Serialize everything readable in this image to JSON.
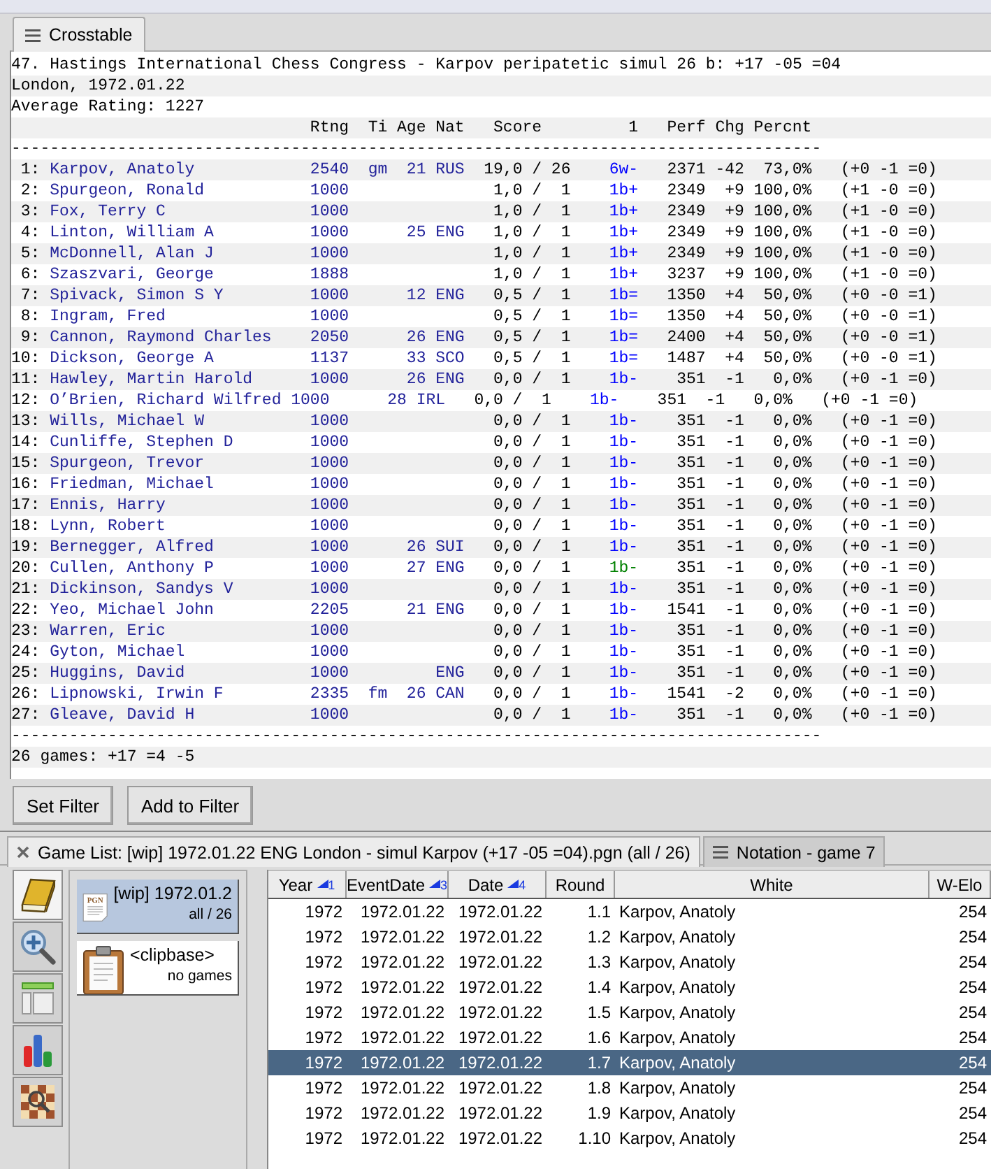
{
  "top_tab": {
    "label": "Crosstable",
    "selected": true
  },
  "crosstable": {
    "title_line": "47. Hastings International Chess Congress - Karpov peripatetic simul 26 b: +17 -05 =04",
    "place_line": "London, 1972.01.22",
    "average_line": "Average Rating: 1227",
    "header": {
      "rating": "Rtng",
      "title": "Ti",
      "age": "Age",
      "nat": "Nat",
      "score": "Score",
      "round_1": "1",
      "perf": "Perf",
      "chg": "Chg",
      "pct": "Percnt"
    },
    "separator_top": "------------------------------------------------------------------------------------",
    "rows": [
      {
        "num": "1:",
        "name": "Karpov, Anatoly",
        "rating": "2540",
        "title": "gm",
        "age": "21",
        "nat": "RUS",
        "score": "19,0 / 26",
        "result": {
          "text": "6w-",
          "color": "#0000ff"
        },
        "perf": "2371",
        "chg": "-42",
        "pct": "73,0%",
        "record": "(+0 -1 =0)"
      },
      {
        "num": "2:",
        "name": "Spurgeon, Ronald",
        "rating": "1000",
        "score": "1,0 /  1",
        "result": {
          "text": "1b+",
          "color": "#0000ff"
        },
        "perf": "2349",
        "chg": "+9",
        "pct": "100,0%",
        "record": "(+1 -0 =0)"
      },
      {
        "num": "3:",
        "name": "Fox, Terry C",
        "rating": "1000",
        "score": "1,0 /  1",
        "result": {
          "text": "1b+",
          "color": "#0000ff"
        },
        "perf": "2349",
        "chg": "+9",
        "pct": "100,0%",
        "record": "(+1 -0 =0)"
      },
      {
        "num": "4:",
        "name": "Linton, William A",
        "rating": "1000",
        "age": "25",
        "nat": "ENG",
        "score": "1,0 /  1",
        "result": {
          "text": "1b+",
          "color": "#0000ff"
        },
        "perf": "2349",
        "chg": "+9",
        "pct": "100,0%",
        "record": "(+1 -0 =0)"
      },
      {
        "num": "5:",
        "name": "McDonnell, Alan J",
        "rating": "1000",
        "score": "1,0 /  1",
        "result": {
          "text": "1b+",
          "color": "#0000ff"
        },
        "perf": "2349",
        "chg": "+9",
        "pct": "100,0%",
        "record": "(+1 -0 =0)"
      },
      {
        "num": "6:",
        "name": "Szaszvari, George",
        "rating": "1888",
        "score": "1,0 /  1",
        "result": {
          "text": "1b+",
          "color": "#0000ff"
        },
        "perf": "3237",
        "chg": "+9",
        "pct": "100,0%",
        "record": "(+1 -0 =0)"
      },
      {
        "num": "7:",
        "name": "Spivack, Simon S Y",
        "rating": "1000",
        "age": "12",
        "nat": "ENG",
        "score": "0,5 /  1",
        "result": {
          "text": "1b=",
          "color": "#0000ff"
        },
        "perf": "1350",
        "chg": "+4",
        "pct": "50,0%",
        "record": "(+0 -0 =1)"
      },
      {
        "num": "8:",
        "name": "Ingram, Fred",
        "rating": "1000",
        "score": "0,5 /  1",
        "result": {
          "text": "1b=",
          "color": "#0000ff"
        },
        "perf": "1350",
        "chg": "+4",
        "pct": "50,0%",
        "record": "(+0 -0 =1)"
      },
      {
        "num": "9:",
        "name": "Cannon, Raymond Charles",
        "rating": "2050",
        "age": "26",
        "nat": "ENG",
        "score": "0,5 /  1",
        "result": {
          "text": "1b=",
          "color": "#0000ff"
        },
        "perf": "2400",
        "chg": "+4",
        "pct": "50,0%",
        "record": "(+0 -0 =1)"
      },
      {
        "num": "10:",
        "name": "Dickson, George A",
        "rating": "1137",
        "age": "33",
        "nat": "SCO",
        "score": "0,5 /  1",
        "result": {
          "text": "1b=",
          "color": "#0000ff"
        },
        "perf": "1487",
        "chg": "+4",
        "pct": "50,0%",
        "record": "(+0 -0 =1)"
      },
      {
        "num": "11:",
        "name": "Hawley, Martin Harold",
        "rating": "1000",
        "age": "26",
        "nat": "ENG",
        "score": "0,0 /  1",
        "result": {
          "text": "1b-",
          "color": "#0000ff"
        },
        "perf": "351",
        "chg": "-1",
        "pct": "0,0%",
        "record": "(+0 -1 =0)"
      },
      {
        "num": "12:",
        "name": "O’Brien, Richard Wilfred",
        "rating": "1000",
        "age": "28",
        "nat": "IRL",
        "score": "0,0 /  1",
        "result": {
          "text": "1b-",
          "color": "#0000ff"
        },
        "perf": "351",
        "chg": "-1",
        "pct": "0,0%",
        "record": "(+0 -1 =0)"
      },
      {
        "num": "13:",
        "name": "Wills, Michael W",
        "rating": "1000",
        "score": "0,0 /  1",
        "result": {
          "text": "1b-",
          "color": "#0000ff"
        },
        "perf": "351",
        "chg": "-1",
        "pct": "0,0%",
        "record": "(+0 -1 =0)"
      },
      {
        "num": "14:",
        "name": "Cunliffe, Stephen D",
        "rating": "1000",
        "score": "0,0 /  1",
        "result": {
          "text": "1b-",
          "color": "#0000ff"
        },
        "perf": "351",
        "chg": "-1",
        "pct": "0,0%",
        "record": "(+0 -1 =0)"
      },
      {
        "num": "15:",
        "name": "Spurgeon, Trevor",
        "rating": "1000",
        "score": "0,0 /  1",
        "result": {
          "text": "1b-",
          "color": "#0000ff"
        },
        "perf": "351",
        "chg": "-1",
        "pct": "0,0%",
        "record": "(+0 -1 =0)"
      },
      {
        "num": "16:",
        "name": "Friedman, Michael",
        "rating": "1000",
        "score": "0,0 /  1",
        "result": {
          "text": "1b-",
          "color": "#0000ff"
        },
        "perf": "351",
        "chg": "-1",
        "pct": "0,0%",
        "record": "(+0 -1 =0)"
      },
      {
        "num": "17:",
        "name": "Ennis, Harry",
        "rating": "1000",
        "score": "0,0 /  1",
        "result": {
          "text": "1b-",
          "color": "#0000ff"
        },
        "perf": "351",
        "chg": "-1",
        "pct": "0,0%",
        "record": "(+0 -1 =0)"
      },
      {
        "num": "18:",
        "name": "Lynn, Robert",
        "rating": "1000",
        "score": "0,0 /  1",
        "result": {
          "text": "1b-",
          "color": "#0000ff"
        },
        "perf": "351",
        "chg": "-1",
        "pct": "0,0%",
        "record": "(+0 -1 =0)"
      },
      {
        "num": "19:",
        "name": "Bernegger, Alfred",
        "rating": "1000",
        "age": "26",
        "nat": "SUI",
        "score": "0,0 /  1",
        "result": {
          "text": "1b-",
          "color": "#0000ff"
        },
        "perf": "351",
        "chg": "-1",
        "pct": "0,0%",
        "record": "(+0 -1 =0)"
      },
      {
        "num": "20:",
        "name": "Cullen, Anthony P",
        "rating": "1000",
        "age": "27",
        "nat": "ENG",
        "score": "0,0 /  1",
        "result": {
          "text": "1b-",
          "color": "#008000"
        },
        "perf": "351",
        "chg": "-1",
        "pct": "0,0%",
        "record": "(+0 -1 =0)"
      },
      {
        "num": "21:",
        "name": "Dickinson, Sandys V",
        "rating": "1000",
        "score": "0,0 /  1",
        "result": {
          "text": "1b-",
          "color": "#0000ff"
        },
        "perf": "351",
        "chg": "-1",
        "pct": "0,0%",
        "record": "(+0 -1 =0)"
      },
      {
        "num": "22:",
        "name": "Yeo, Michael John",
        "rating": "2205",
        "age": "21",
        "nat": "ENG",
        "score": "0,0 /  1",
        "result": {
          "text": "1b-",
          "color": "#0000ff"
        },
        "perf": "1541",
        "chg": "-1",
        "pct": "0,0%",
        "record": "(+0 -1 =0)"
      },
      {
        "num": "23:",
        "name": "Warren, Eric",
        "rating": "1000",
        "score": "0,0 /  1",
        "result": {
          "text": "1b-",
          "color": "#0000ff"
        },
        "perf": "351",
        "chg": "-1",
        "pct": "0,0%",
        "record": "(+0 -1 =0)"
      },
      {
        "num": "24:",
        "name": "Gyton, Michael",
        "rating": "1000",
        "score": "0,0 /  1",
        "result": {
          "text": "1b-",
          "color": "#0000ff"
        },
        "perf": "351",
        "chg": "-1",
        "pct": "0,0%",
        "record": "(+0 -1 =0)"
      },
      {
        "num": "25:",
        "name": "Huggins, David",
        "rating": "1000",
        "nat": "ENG",
        "score": "0,0 /  1",
        "result": {
          "text": "1b-",
          "color": "#0000ff"
        },
        "perf": "351",
        "chg": "-1",
        "pct": "0,0%",
        "record": "(+0 -1 =0)"
      },
      {
        "num": "26:",
        "name": "Lipnowski, Irwin F",
        "rating": "2335",
        "title": "fm",
        "age": "26",
        "nat": "CAN",
        "score": "0,0 /  1",
        "result": {
          "text": "1b-",
          "color": "#0000ff"
        },
        "perf": "1541",
        "chg": "-2",
        "pct": "0,0%",
        "record": "(+0 -1 =0)"
      },
      {
        "num": "27:",
        "name": "Gleave, David H",
        "rating": "1000",
        "score": "0,0 /  1",
        "result": {
          "text": "1b-",
          "color": "#0000ff"
        },
        "perf": "351",
        "chg": "-1",
        "pct": "0,0%",
        "record": "(+0 -1 =0)"
      }
    ],
    "separator_bottom": "------------------------------------------------------------------------------------",
    "summary": "26 games: +17 =4 -5"
  },
  "buttons": [
    {
      "label": "Set Filter"
    },
    {
      "label": "Add to Filter"
    }
  ],
  "tabs": [
    {
      "kind": "closable",
      "label": "Game List: [wip] 1972.01.22 ENG London - simul Karpov (+17 -05 =04).pgn (all / 26)",
      "selected": true
    },
    {
      "kind": "menu",
      "label": "Notation - game 7",
      "selected": false
    }
  ],
  "toolbar": [
    {
      "kind": "databases",
      "selected": true
    },
    {
      "kind": "search",
      "selected": false
    },
    {
      "kind": "layout",
      "selected": false
    },
    {
      "kind": "statistics",
      "selected": false
    },
    {
      "kind": "board_search",
      "selected": false
    }
  ],
  "databases": [
    {
      "kind": "pgn",
      "icon_text": "PGN",
      "name": "[wip] 1972.01.2",
      "count": "all / 26",
      "selected": true
    },
    {
      "kind": "clipbase",
      "name": "<clipbase>",
      "count": "no games",
      "selected": false
    }
  ],
  "game_list": {
    "columns": [
      {
        "label": "Year",
        "sort": "1"
      },
      {
        "label": "EventDate",
        "sort": "3"
      },
      {
        "label": "Date",
        "sort": "4"
      },
      {
        "label": "Round"
      },
      {
        "label": "White"
      },
      {
        "label": "W-Elo"
      }
    ],
    "rows": [
      {
        "year": "1972",
        "event_date": "1972.01.22",
        "date": "1972.01.22",
        "round": "1.1",
        "white": "Karpov, Anatoly",
        "white_elo": "254",
        "selected": false
      },
      {
        "year": "1972",
        "event_date": "1972.01.22",
        "date": "1972.01.22",
        "round": "1.2",
        "white": "Karpov, Anatoly",
        "white_elo": "254",
        "selected": false
      },
      {
        "year": "1972",
        "event_date": "1972.01.22",
        "date": "1972.01.22",
        "round": "1.3",
        "white": "Karpov, Anatoly",
        "white_elo": "254",
        "selected": false
      },
      {
        "year": "1972",
        "event_date": "1972.01.22",
        "date": "1972.01.22",
        "round": "1.4",
        "white": "Karpov, Anatoly",
        "white_elo": "254",
        "selected": false
      },
      {
        "year": "1972",
        "event_date": "1972.01.22",
        "date": "1972.01.22",
        "round": "1.5",
        "white": "Karpov, Anatoly",
        "white_elo": "254",
        "selected": false
      },
      {
        "year": "1972",
        "event_date": "1972.01.22",
        "date": "1972.01.22",
        "round": "1.6",
        "white": "Karpov, Anatoly",
        "white_elo": "254",
        "selected": false
      },
      {
        "year": "1972",
        "event_date": "1972.01.22",
        "date": "1972.01.22",
        "round": "1.7",
        "white": "Karpov, Anatoly",
        "white_elo": "254",
        "selected": true
      },
      {
        "year": "1972",
        "event_date": "1972.01.22",
        "date": "1972.01.22",
        "round": "1.8",
        "white": "Karpov, Anatoly",
        "white_elo": "254",
        "selected": false
      },
      {
        "year": "1972",
        "event_date": "1972.01.22",
        "date": "1972.01.22",
        "round": "1.9",
        "white": "Karpov, Anatoly",
        "white_elo": "254",
        "selected": false
      },
      {
        "year": "1972",
        "event_date": "1972.01.22",
        "date": "1972.01.22",
        "round": "1.10",
        "white": "Karpov, Anatoly",
        "white_elo": "254",
        "selected": false
      }
    ]
  }
}
